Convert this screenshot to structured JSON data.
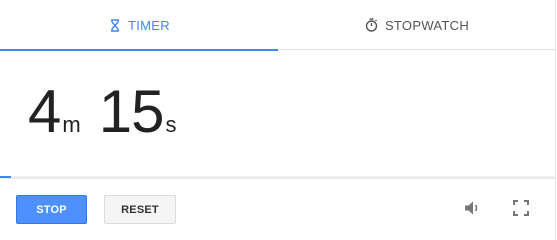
{
  "tabs": {
    "timer": {
      "label": "TIMER",
      "icon": "hourglass-icon",
      "active": true
    },
    "stopwatch": {
      "label": "STOPWATCH",
      "icon": "stopwatch-icon",
      "active": false
    }
  },
  "time": {
    "minutes": "4",
    "minutes_unit": "m",
    "seconds": "15",
    "seconds_unit": "s"
  },
  "progress": {
    "fraction": 0.02
  },
  "controls": {
    "stop_label": "STOP",
    "reset_label": "RESET",
    "sound_icon": "speaker-icon",
    "fullscreen_icon": "fullscreen-icon"
  },
  "colors": {
    "accent": "#4285f4",
    "stop_button": "#4d90fe",
    "reset_button": "#f5f5f5",
    "text": "#222222",
    "icon": "#757575"
  }
}
